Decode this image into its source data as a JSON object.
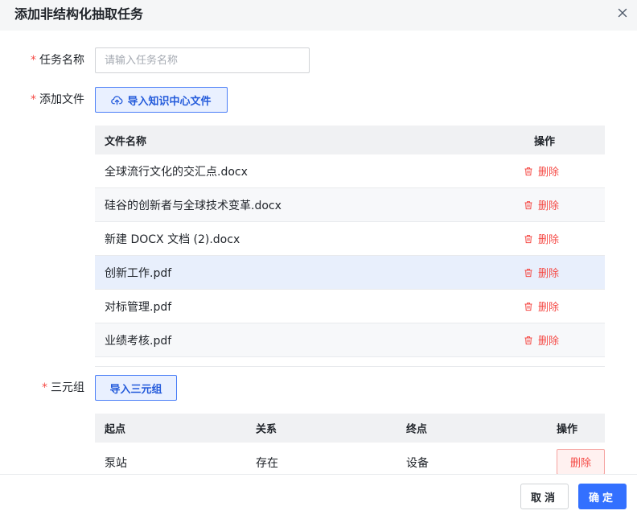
{
  "dialog": {
    "title": "添加非结构化抽取任务",
    "close_icon": "close-icon"
  },
  "form": {
    "task_name": {
      "required_mark": "*",
      "label": "任务名称",
      "placeholder": "请输入任务名称",
      "value": ""
    },
    "add_file": {
      "required_mark": "*",
      "label": "添加文件",
      "import_button": "导入知识中心文件",
      "import_icon": "cloud-upload-icon"
    },
    "file_table": {
      "columns": [
        "文件名称",
        "操作"
      ],
      "rows": [
        {
          "name": "全球流行文化的交汇点.docx",
          "action": "删除"
        },
        {
          "name": "硅谷的创新者与全球技术变革.docx",
          "action": "删除"
        },
        {
          "name": "新建 DOCX 文档 (2).docx",
          "action": "删除"
        },
        {
          "name": "创新工作.pdf",
          "action": "删除"
        },
        {
          "name": "对标管理.pdf",
          "action": "删除"
        },
        {
          "name": "业绩考核.pdf",
          "action": "删除"
        }
      ],
      "delete_icon": "trash-icon"
    },
    "triples": {
      "required_mark": "*",
      "label": "三元组",
      "import_button": "导入三元组",
      "columns": [
        "起点",
        "关系",
        "终点",
        "操作"
      ],
      "rows": [
        {
          "start": "泵站",
          "relation": "存在",
          "end": "设备",
          "action": "删除"
        }
      ]
    }
  },
  "footer": {
    "cancel_label": "取消",
    "ok_label": "确定"
  },
  "colors": {
    "primary": "#3370ff",
    "danger": "#f54a45",
    "header_bg": "#f5f6f7"
  }
}
